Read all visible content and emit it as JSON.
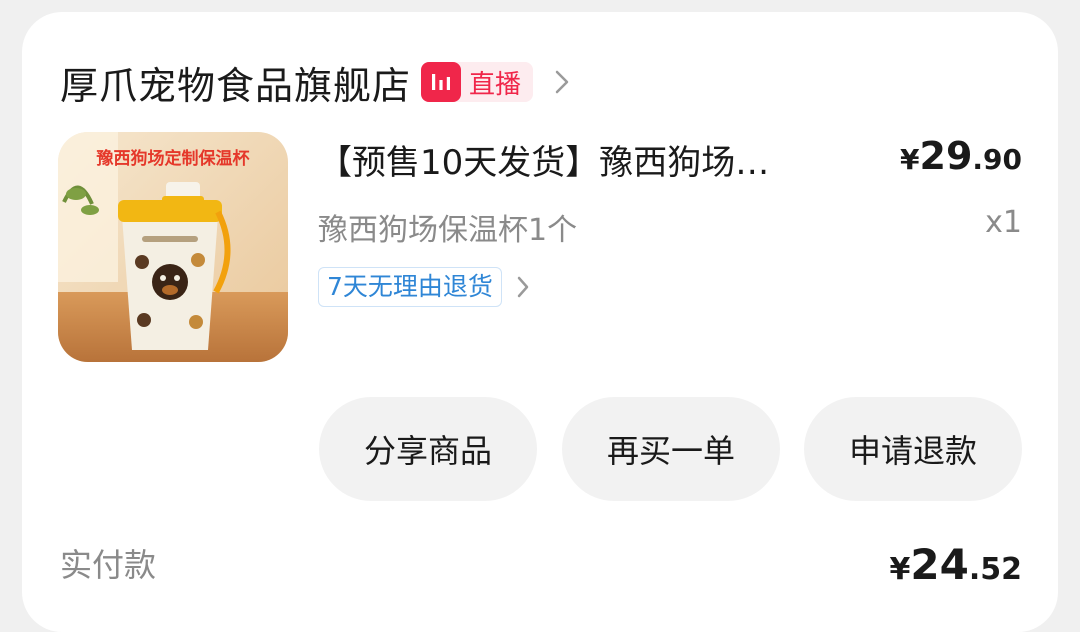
{
  "store": {
    "name": "厚爪宠物食品旗舰店",
    "live_label": "直播",
    "live_icon": "live-bars-icon",
    "chevron_icon": "chevron-right-icon"
  },
  "product": {
    "image_caption": "豫西狗场定制保温杯",
    "image_icon": "product-thumbnail",
    "title": "【预售10天发货】豫西狗场…",
    "price": {
      "currency": "¥",
      "integer": "29",
      "decimal": ".90"
    },
    "spec": "豫西狗场保温杯1个",
    "quantity": "x1",
    "return_policy": "7天无理由退货"
  },
  "actions": {
    "share": "分享商品",
    "rebuy": "再买一单",
    "refund": "申请退款"
  },
  "payment": {
    "label": "实付款",
    "currency": "¥",
    "integer": "24",
    "decimal": ".52"
  },
  "colors": {
    "accent_red": "#f0264a",
    "link_blue": "#2f86d6",
    "text_primary": "#1a1a1a",
    "text_secondary": "#8a8a8a"
  }
}
